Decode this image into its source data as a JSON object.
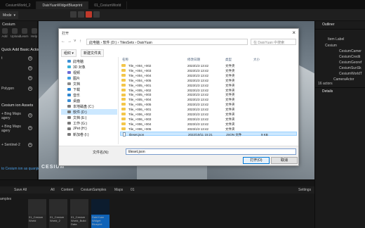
{
  "tabs": [
    "CesiumWorld_2",
    "DaisYuanWidgetBlueprint",
    "01_CesiumWorld"
  ],
  "toolbar": {
    "mode": "Mode"
  },
  "left_panel": {
    "title": "Cesium",
    "quick": [
      {
        "label": "Add"
      },
      {
        "label": "Upload"
      },
      {
        "label": "Learn"
      },
      {
        "label": "Help"
      }
    ],
    "heading_quick_add": "Quick Add Basic Actors",
    "row_a": "t",
    "row_polygon": "Polygon",
    "heading_ion": "Cesium ion Assets",
    "row_bing1": "+ Bing Maps",
    "row_bing1b": "agery",
    "row_bing2": "+ Bing Maps",
    "row_bing2b": "agery",
    "row_sentinel": "+ Sentinel-2",
    "row_connect": "to Cesium ion as quanjie"
  },
  "viewport": {
    "logo": "CESIUM"
  },
  "outliner": {
    "title": "Outliner",
    "header_label": "Item Label",
    "items": [
      "Cesium",
      "CesiumCamer",
      "CesiumCredit",
      "CesiumGeoref",
      "CesiumSunSk",
      "CesiumWorldT",
      "CameraActor"
    ],
    "count": "16 actors",
    "details": "Details"
  },
  "content_browser": {
    "save_all": "Save All",
    "path": [
      "All",
      "Content",
      "CesiumSamples",
      "Maps",
      "01"
    ],
    "settings": "Settings",
    "left_label": "amples",
    "assets": [
      "01_Cesium World",
      "01_Cesium World_2",
      "01_Cesium World_Build Data",
      "DaisYuan Widget Bluepint"
    ]
  },
  "dialog": {
    "title": "打开",
    "address": "此电脑  ›  软件 (D:)  ›  TilesSets  ›  DaisYuan",
    "search_placeholder": "在 DaisYuan 中搜索",
    "organize": "组织 ▾",
    "new_folder": "新建文件夹",
    "nav": [
      "此电脑",
      "3D 对象",
      "视频",
      "图片",
      "文档",
      "下载",
      "音乐",
      "桌面",
      "本地磁盘 (C:)",
      "软件 (D:)",
      "文档 (E:)",
      "工作 (G:)",
      "JPet (H:)",
      "新加卷 (I:)"
    ],
    "columns": {
      "name": "名称",
      "date": "修改日期",
      "type": "类型",
      "size": "大小"
    },
    "files": [
      {
        "name": "Tile_+004_+002",
        "date": "2023/1/3 13:42",
        "type": "文件夹",
        "size": ""
      },
      {
        "name": "Tile_+004_+003",
        "date": "2023/1/3 13:42",
        "type": "文件夹",
        "size": ""
      },
      {
        "name": "Tile_+004_+004",
        "date": "2023/1/3 13:42",
        "type": "文件夹",
        "size": ""
      },
      {
        "name": "Tile_+004_+005",
        "date": "2023/1/3 13:42",
        "type": "文件夹",
        "size": ""
      },
      {
        "name": "Tile_+005_+001",
        "date": "2023/1/3 13:42",
        "type": "文件夹",
        "size": ""
      },
      {
        "name": "Tile_+005_+002",
        "date": "2023/1/3 13:42",
        "type": "文件夹",
        "size": ""
      },
      {
        "name": "Tile_+005_+003",
        "date": "2023/1/3 13:42",
        "type": "文件夹",
        "size": ""
      },
      {
        "name": "Tile_+005_+004",
        "date": "2023/1/3 13:42",
        "type": "文件夹",
        "size": ""
      },
      {
        "name": "Tile_+005_+005",
        "date": "2023/1/3 13:42",
        "type": "文件夹",
        "size": ""
      },
      {
        "name": "Tile_+006_+001",
        "date": "2023/1/3 13:42",
        "type": "文件夹",
        "size": ""
      },
      {
        "name": "Tile_+006_+002",
        "date": "2023/1/3 13:42",
        "type": "文件夹",
        "size": ""
      },
      {
        "name": "Tile_+006_+003",
        "date": "2023/1/3 13:42",
        "type": "文件夹",
        "size": ""
      },
      {
        "name": "Tile_+006_+004",
        "date": "2023/1/3 13:42",
        "type": "文件夹",
        "size": ""
      },
      {
        "name": "Tile_+006_+005",
        "date": "2023/1/3 13:42",
        "type": "文件夹",
        "size": ""
      },
      {
        "name": "tileset.json",
        "date": "2022/10/11 15:21",
        "type": "JSON 文件",
        "size": "9 KB"
      }
    ],
    "filename_label": "文件名(N):",
    "filename_value": "tileset.json",
    "open_btn": "打开(O)",
    "cancel_btn": "取消"
  },
  "colors": {
    "accent": "#0f63b8",
    "selection": "#cce8ff",
    "folder": "#f3c64a"
  }
}
